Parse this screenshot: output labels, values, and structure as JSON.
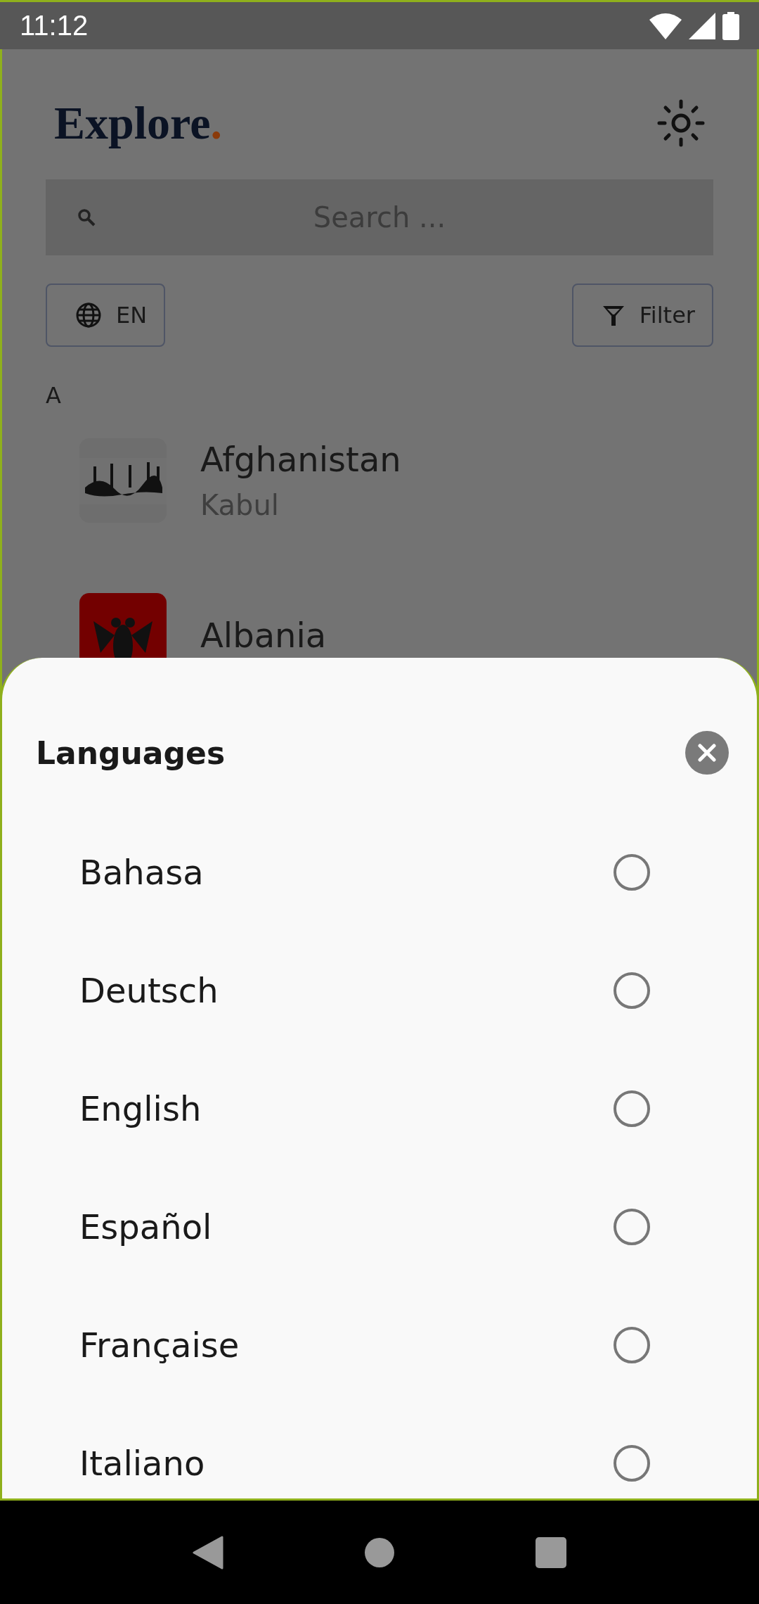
{
  "status_bar": {
    "time": "11:12"
  },
  "header": {
    "logo": "Explore",
    "logo_dot": "."
  },
  "search": {
    "placeholder": "Search ..."
  },
  "language_button": {
    "label": "EN"
  },
  "filter_button": {
    "label": "Filter"
  },
  "sections": [
    {
      "letter": "A",
      "countries": [
        {
          "name": "Afghanistan",
          "capital": "Kabul"
        },
        {
          "name": "Albania"
        }
      ]
    }
  ],
  "sheet": {
    "title": "Languages",
    "options": [
      {
        "label": "Bahasa",
        "selected": false
      },
      {
        "label": "Deutsch",
        "selected": false
      },
      {
        "label": "English",
        "selected": false
      },
      {
        "label": "Español",
        "selected": false
      },
      {
        "label": "Française",
        "selected": false
      },
      {
        "label": "Italiano",
        "selected": false
      }
    ]
  }
}
